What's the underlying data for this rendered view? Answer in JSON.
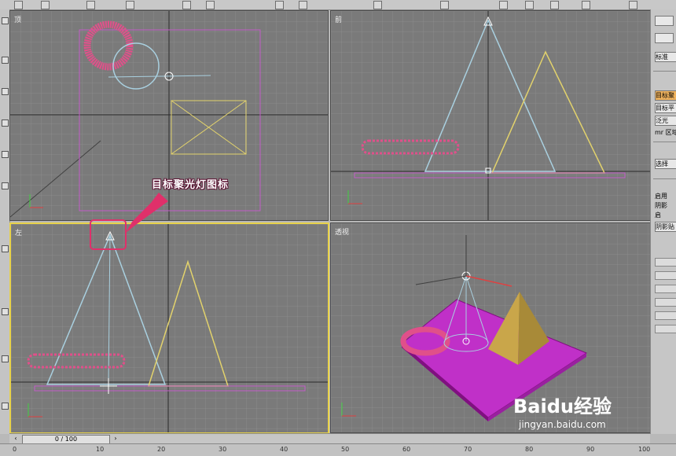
{
  "viewports": {
    "top": {
      "label": "顶"
    },
    "front": {
      "label": "前"
    },
    "left": {
      "label": "左"
    },
    "perspective": {
      "label": "透视"
    }
  },
  "annotation": {
    "text": "目标聚光灯图标",
    "color": "#e0306a"
  },
  "timeline": {
    "frame_display": "0 / 100",
    "ruler_ticks": [
      "0",
      "10",
      "20",
      "30",
      "40",
      "50",
      "60",
      "70",
      "80",
      "90",
      "100"
    ]
  },
  "command_panel": {
    "type_field": "标准",
    "items": [
      "目标聚",
      "目标平",
      "泛光",
      "mr 区域"
    ],
    "search_field": "选择",
    "shadow_section": "阴影",
    "enable_label": "启用",
    "enable2_label": "启",
    "shadow_map": "阴影贴"
  },
  "watermark": {
    "brand": "Baidu经验",
    "url": "jingyan.baidu.com"
  },
  "colors": {
    "viewport_bg": "#7a7a7a",
    "grid": "#8b8b8b",
    "active_border": "#e8d24a",
    "light_cone": "#a9d0e0",
    "pyramid_outline": "#e2d26c",
    "torus": "#e0508a",
    "plane": "#c030c8"
  }
}
